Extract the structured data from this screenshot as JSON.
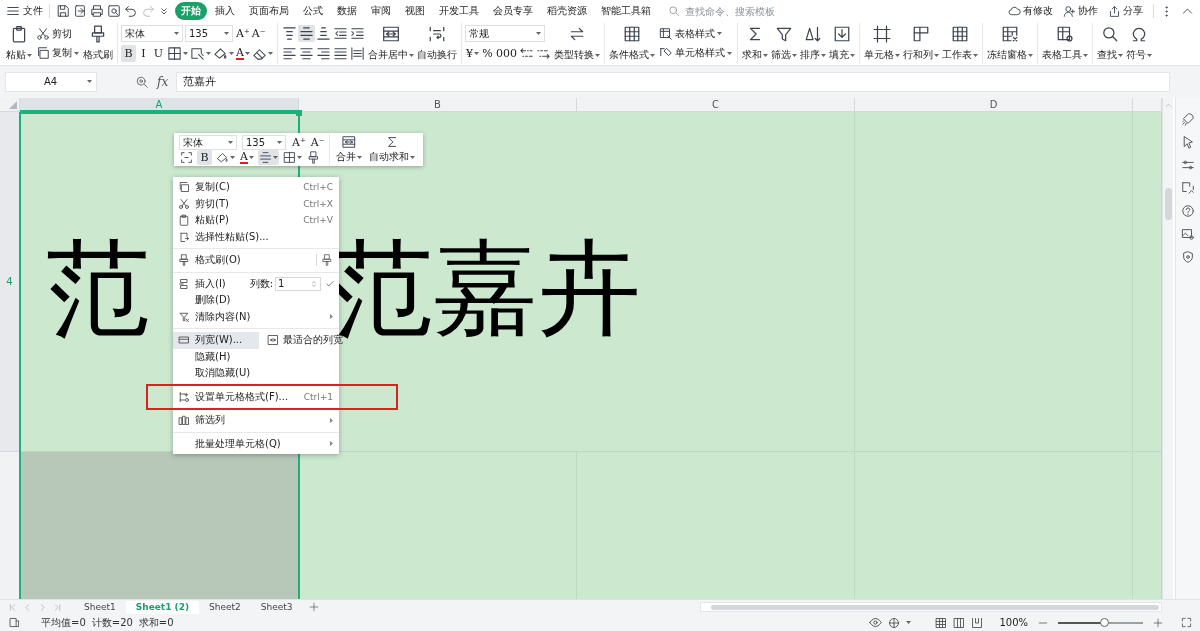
{
  "menu_bar": {
    "file": "文件",
    "tabs": [
      {
        "label": "开始",
        "selected": true
      },
      {
        "label": "插入",
        "selected": false
      },
      {
        "label": "页面布局",
        "selected": false
      },
      {
        "label": "公式",
        "selected": false
      },
      {
        "label": "数据",
        "selected": false
      },
      {
        "label": "审阅",
        "selected": false
      },
      {
        "label": "视图",
        "selected": false
      },
      {
        "label": "开发工具",
        "selected": false
      },
      {
        "label": "会员专享",
        "selected": false
      },
      {
        "label": "稻壳资源",
        "selected": false
      },
      {
        "label": "智能工具箱",
        "selected": false
      }
    ],
    "search": {
      "placeholder": "查找命令、搜索模板"
    },
    "actions": [
      "有修改",
      "协作",
      "分享"
    ]
  },
  "ribbon": {
    "groups": [
      {
        "items": [
          {
            "kind": "big",
            "label": "粘贴",
            "dropdown": true
          },
          {
            "kind": "small",
            "label": "剪切"
          },
          {
            "kind": "small",
            "label": "复制",
            "dropdown": true
          },
          {
            "kind": "big",
            "label": "格式刷"
          }
        ]
      },
      {
        "upper": [
          {
            "kind": "font_field",
            "value": "宋体"
          },
          {
            "kind": "size_field",
            "value": "135"
          },
          {
            "kind": "glyph",
            "label": "A⁺"
          },
          {
            "kind": "glyph",
            "label": "A⁻"
          }
        ],
        "lower": [
          {
            "kind": "glyph",
            "label": "B",
            "on": true
          },
          {
            "kind": "glyph",
            "label": "I",
            "on": false
          },
          {
            "kind": "glyph",
            "label": "U",
            "on": false
          },
          {
            "kind": "tool",
            "dropdown": true
          },
          {
            "kind": "tool",
            "dropdown": true
          },
          {
            "kind": "tool",
            "dropdown": true
          },
          {
            "kind": "color_glyph",
            "label": "A",
            "dropdown": true
          },
          {
            "kind": "tool",
            "dropdown": true
          }
        ]
      },
      {
        "upper": [
          {
            "kind": "tool",
            "on": false
          },
          {
            "kind": "tool",
            "on": true
          },
          {
            "kind": "tool",
            "on": false
          },
          {
            "kind": "tool",
            "on": false
          },
          {
            "kind": "tool",
            "on": false
          }
        ],
        "lower": [
          {
            "kind": "tool",
            "on": false
          },
          {
            "kind": "tool",
            "on": false
          },
          {
            "kind": "tool",
            "on": false
          },
          {
            "kind": "tool",
            "on": false
          },
          {
            "kind": "tool",
            "on": false
          }
        ],
        "items": [
          {
            "kind": "big",
            "label": "合并居中",
            "dropdown": true
          },
          {
            "kind": "big",
            "label": "自动换行"
          }
        ]
      },
      {
        "upper": [
          {
            "kind": "format_field",
            "value": "常规"
          }
        ],
        "lower": [
          {
            "kind": "glyph",
            "label": "¥",
            "dropdown": true
          },
          {
            "kind": "glyph",
            "label": "%"
          },
          {
            "kind": "glyph",
            "label": "000"
          },
          {
            "kind": "tool"
          },
          {
            "kind": "tool"
          }
        ],
        "items": [
          {
            "kind": "big",
            "label": "类型转换",
            "dropdown": true
          }
        ]
      },
      {
        "items": [
          {
            "kind": "big",
            "label": "条件格式",
            "dropdown": true
          },
          {
            "kind": "small",
            "label": "表格样式",
            "dropdown": true
          },
          {
            "kind": "small",
            "label": "单元格样式",
            "dropdown": true
          }
        ]
      },
      {
        "items": [
          {
            "kind": "big",
            "label": "求和",
            "dropdown": true
          },
          {
            "kind": "big",
            "label": "筛选",
            "dropdown": true
          },
          {
            "kind": "big",
            "label": "排序",
            "dropdown": true
          },
          {
            "kind": "big",
            "label": "填充",
            "dropdown": true
          }
        ]
      },
      {
        "items": [
          {
            "kind": "big",
            "label": "单元格",
            "dropdown": true
          },
          {
            "kind": "big",
            "label": "行和列",
            "dropdown": true
          },
          {
            "kind": "big",
            "label": "工作表",
            "dropdown": true
          }
        ]
      },
      {
        "items": [
          {
            "kind": "big",
            "label": "冻结窗格",
            "dropdown": true
          }
        ]
      },
      {
        "items": [
          {
            "kind": "big",
            "label": "表格工具",
            "dropdown": true
          }
        ]
      },
      {
        "items": [
          {
            "kind": "big",
            "label": "查找",
            "dropdown": true
          },
          {
            "kind": "big",
            "label": "符号",
            "dropdown": true
          }
        ]
      }
    ]
  },
  "formula_bar": {
    "name_box": "A4",
    "fx": "fx",
    "value": "范嘉卉"
  },
  "sheet": {
    "columns": [
      {
        "label": "A",
        "selected": true
      },
      {
        "label": "B",
        "selected": false
      },
      {
        "label": "C",
        "selected": false
      },
      {
        "label": "D",
        "selected": false
      }
    ],
    "rows": [
      {
        "label": "4",
        "selected": true,
        "cells": [
          "范",
          "范嘉卉"
        ]
      },
      {
        "selected": false
      }
    ]
  },
  "mini_toolbar": {
    "groups": [
      {
        "upper": [
          {
            "kind": "font_field",
            "value": "宋体"
          },
          {
            "kind": "size_field",
            "value": "135"
          },
          {
            "kind": "glyph",
            "label": "A⁺"
          },
          {
            "kind": "glyph",
            "label": "A⁻"
          }
        ],
        "lower": [
          {
            "kind": "tool",
            "on": false
          },
          {
            "kind": "glyph",
            "label": "B",
            "on": true
          },
          {
            "kind": "tool",
            "on": false,
            "dropdown": true
          },
          {
            "kind": "color_glyph",
            "label": "A",
            "dropdown": true
          },
          {
            "kind": "tool",
            "on": true,
            "dropdown": true
          },
          {
            "kind": "tool",
            "on": false,
            "dropdown": true
          },
          {
            "kind": "tool",
            "on": false
          }
        ]
      },
      {
        "items": [
          {
            "kind": "big",
            "label": "合并",
            "dropdown": true
          },
          {
            "kind": "big",
            "label": "自动求和",
            "dropdown": true
          }
        ]
      }
    ]
  },
  "context_menu": {
    "items": [
      {
        "kind": "item",
        "label": "复制(C)",
        "shortcut": "Ctrl+C",
        "selected": false
      },
      {
        "kind": "item",
        "label": "剪切(T)",
        "shortcut": "Ctrl+X",
        "selected": false
      },
      {
        "kind": "item",
        "label": "粘贴(P)",
        "shortcut": "Ctrl+V",
        "selected": false
      },
      {
        "kind": "item",
        "label": "选择性粘贴(S)...",
        "selected": false
      },
      {
        "kind": "divider"
      },
      {
        "kind": "item",
        "label": "格式刷(O)",
        "side_icon": true,
        "selected": false
      },
      {
        "kind": "divider"
      },
      {
        "kind": "item",
        "label": "插入(I)",
        "count_label": "列数:",
        "count_value": "1",
        "selected": false
      },
      {
        "kind": "item",
        "label": "删除(D)",
        "selected": false
      },
      {
        "kind": "item",
        "label": "清除内容(N)",
        "submenu": true,
        "selected": false
      },
      {
        "kind": "divider"
      },
      {
        "kind": "item",
        "label": "列宽(W)...",
        "side_label": "最适合的列宽",
        "selected": true
      },
      {
        "kind": "item",
        "label": "隐藏(H)",
        "selected": false
      },
      {
        "kind": "item",
        "label": "取消隐藏(U)",
        "selected": false
      },
      {
        "kind": "divider"
      },
      {
        "kind": "item",
        "label": "设置单元格格式(F)...",
        "shortcut": "Ctrl+1",
        "selected": false
      },
      {
        "kind": "divider"
      },
      {
        "kind": "item",
        "label": "筛选列",
        "submenu": true,
        "selected": false
      },
      {
        "kind": "divider"
      },
      {
        "kind": "item",
        "label": "批量处理单元格(Q)",
        "submenu": true,
        "selected": false
      }
    ]
  },
  "sheet_tabs": [
    {
      "label": "Sheet1",
      "selected": false
    },
    {
      "label": "Sheet1 (2)",
      "selected": true
    },
    {
      "label": "Sheet2",
      "selected": false
    },
    {
      "label": "Sheet3",
      "selected": false
    }
  ],
  "status_bar": {
    "stats": [
      "平均值=0",
      "计数=20",
      "求和=0"
    ],
    "zoom": "100%",
    "zoom_slider": {
      "level": 0.54
    }
  }
}
